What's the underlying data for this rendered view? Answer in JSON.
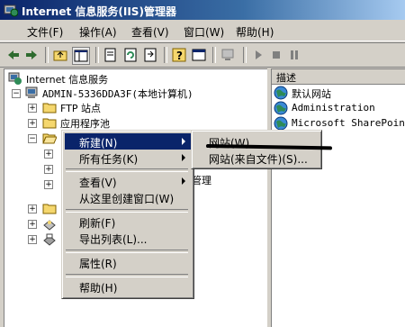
{
  "window": {
    "title": "Internet 信息服务(IIS)管理器",
    "app_icon": "iis-icon"
  },
  "menubar": {
    "items": [
      "文件(F)",
      "操作(A)",
      "查看(V)",
      "窗口(W)",
      "帮助(H)"
    ]
  },
  "toolbar": {
    "buttons": [
      "back-icon",
      "forward-icon",
      "up-folder-icon",
      "show-tree-icon",
      "properties-icon",
      "refresh-icon",
      "export-list-icon",
      "help-icon",
      "console-icon",
      "computer-icon",
      "play-icon",
      "stop-icon",
      "pause-icon"
    ]
  },
  "tree": {
    "root": "Internet 信息服务",
    "computer": "ADMIN-5336DDA3F(本地计算机)",
    "ftp": "FTP 站点",
    "apppools": "应用程序池",
    "partial_visible": "管理"
  },
  "list": {
    "column_header": "描述",
    "items": [
      "默认网站",
      "Administration",
      "Microsoft SharePoint '"
    ]
  },
  "context_menu": {
    "items": [
      {
        "label": "新建(N)",
        "has_submenu": true
      },
      {
        "label": "所有任务(K)",
        "has_submenu": true
      },
      {
        "label": "查看(V)",
        "has_submenu": true
      },
      {
        "label": "从这里创建窗口(W)",
        "has_submenu": false
      },
      {
        "label": "刷新(F)",
        "has_submenu": false
      },
      {
        "label": "导出列表(L)...",
        "has_submenu": false
      },
      {
        "label": "属性(R)",
        "has_submenu": false
      },
      {
        "label": "帮助(H)",
        "has_submenu": false
      }
    ]
  },
  "submenu": {
    "items": [
      "网站(W)...",
      "网站(来自文件)(S)..."
    ]
  }
}
